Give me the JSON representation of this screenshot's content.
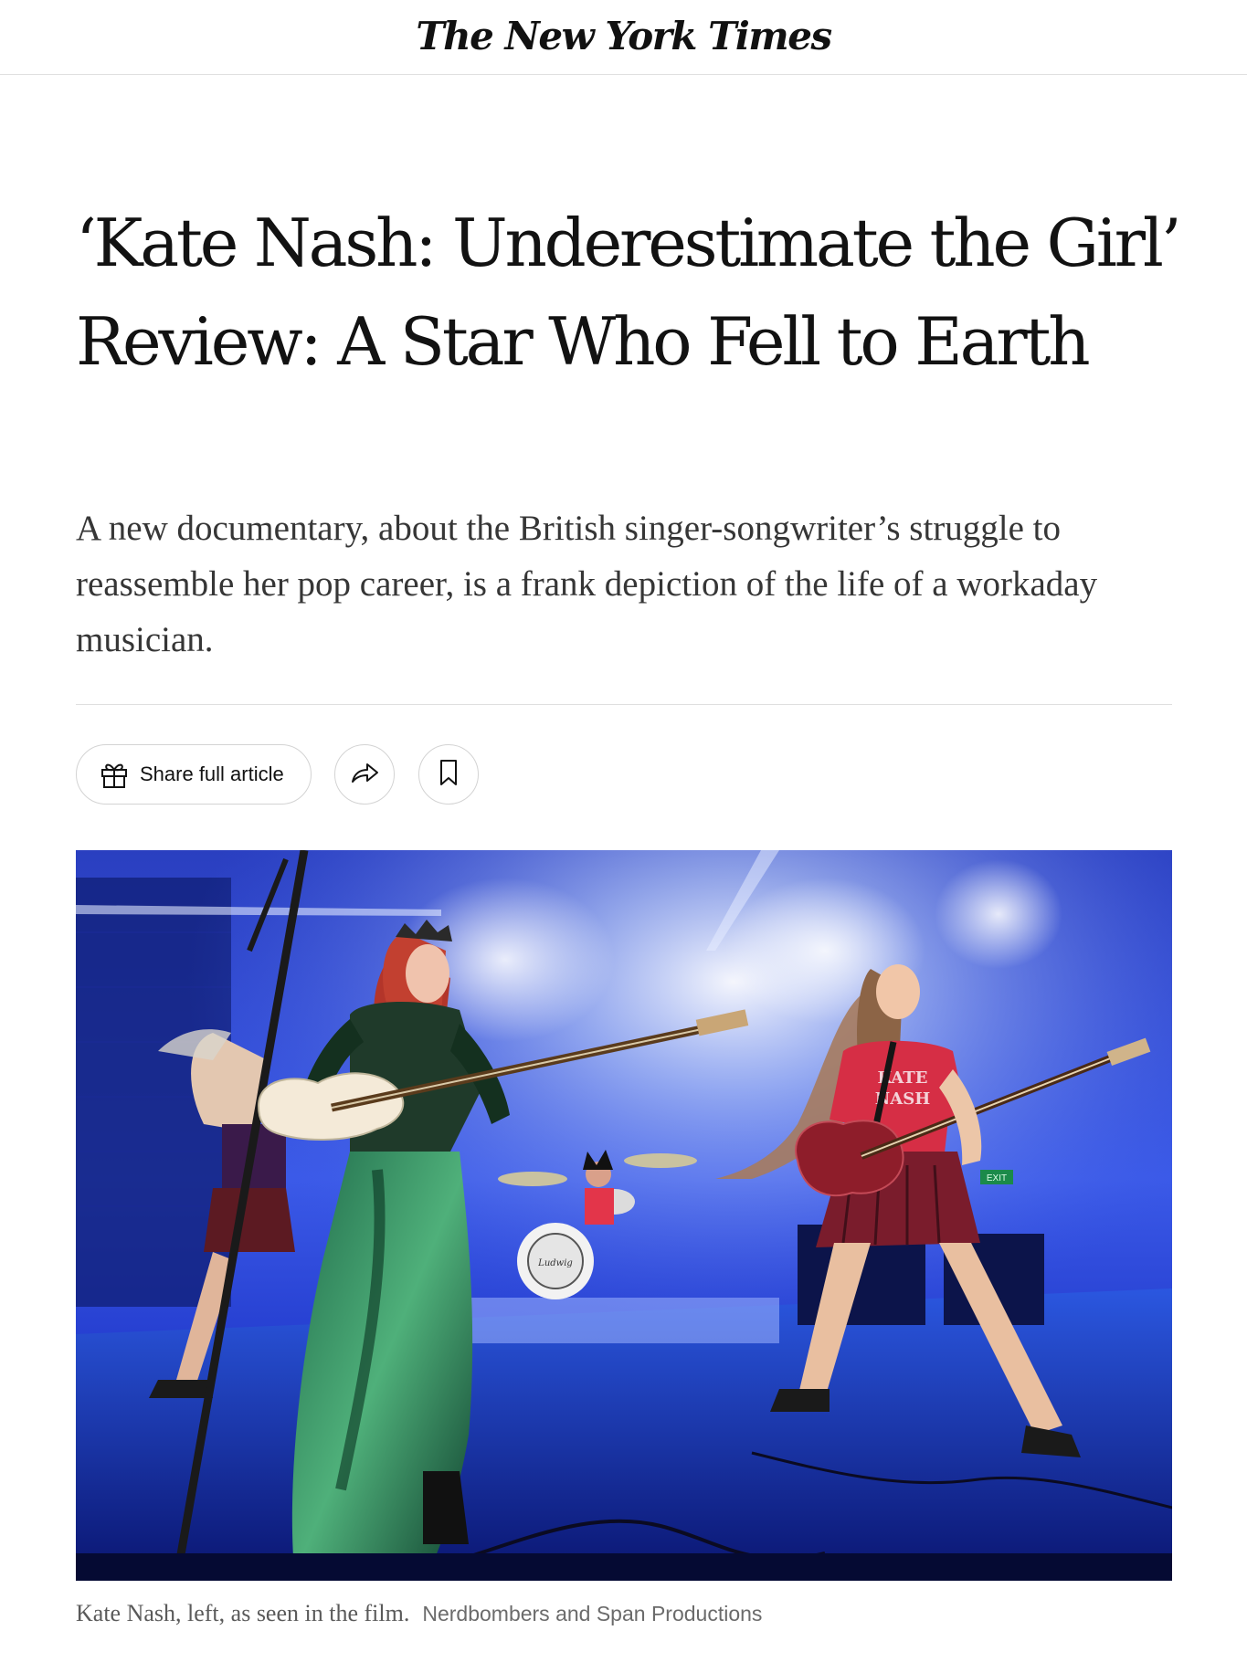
{
  "masthead": {
    "logo_text": "The New York Times"
  },
  "article": {
    "headline": "‘Kate Nash: Underestimate the Girl’ Review: A Star Who Fell to Earth",
    "summary": "A new documentary, about the British singer-songwriter’s struggle to reassemble her pop career, is a frank depiction of the life of a workaday musician."
  },
  "toolbar": {
    "share_label": "Share full article",
    "gift_icon": "gift-icon",
    "share_icon": "share-arrow-icon",
    "save_icon": "bookmark-icon"
  },
  "photo": {
    "caption": "Kate Nash, left, as seen in the film.",
    "credit": "Nerdbombers and Span Productions",
    "shirt_text_line1": "KATE",
    "shirt_text_line2": "NASH",
    "drum_brand": "Ludwig",
    "exit_sign": "EXIT"
  },
  "colors": {
    "text": "#121212",
    "dek_text": "#363636",
    "rule": "#dfdfdf",
    "stage_blue": "#1a3ad0"
  }
}
